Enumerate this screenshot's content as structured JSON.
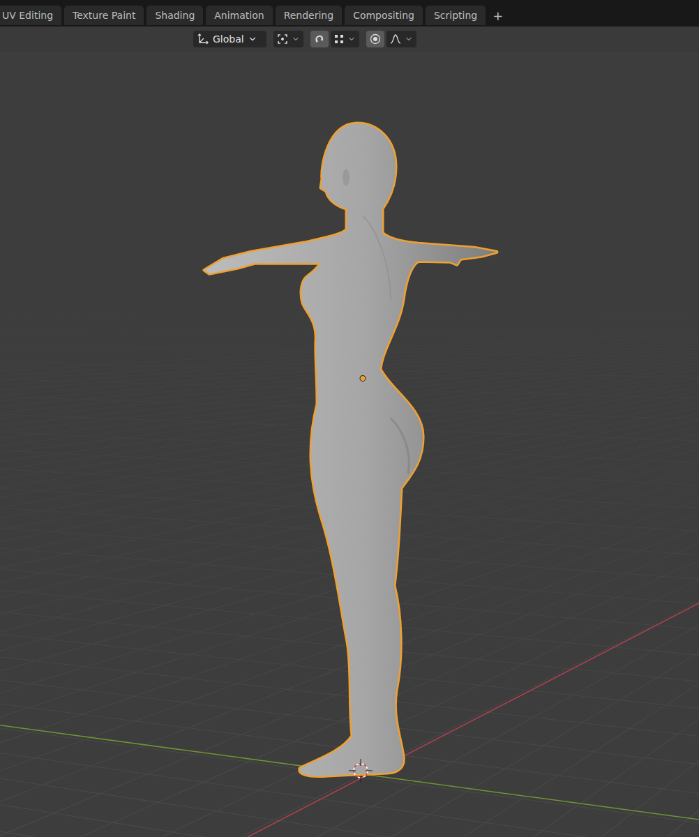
{
  "tabs": [
    {
      "label": "UV Editing",
      "selected": false
    },
    {
      "label": "Texture Paint",
      "selected": false
    },
    {
      "label": "Shading",
      "selected": false
    },
    {
      "label": "Animation",
      "selected": false
    },
    {
      "label": "Rendering",
      "selected": false
    },
    {
      "label": "Compositing",
      "selected": false
    },
    {
      "label": "Scripting",
      "selected": false
    }
  ],
  "add_tab": "+",
  "header": {
    "transform_orientation": "Global",
    "snap": {
      "on": true
    },
    "proportional_editing": {
      "on": true
    }
  },
  "viewport": {
    "object_selected": true
  }
}
